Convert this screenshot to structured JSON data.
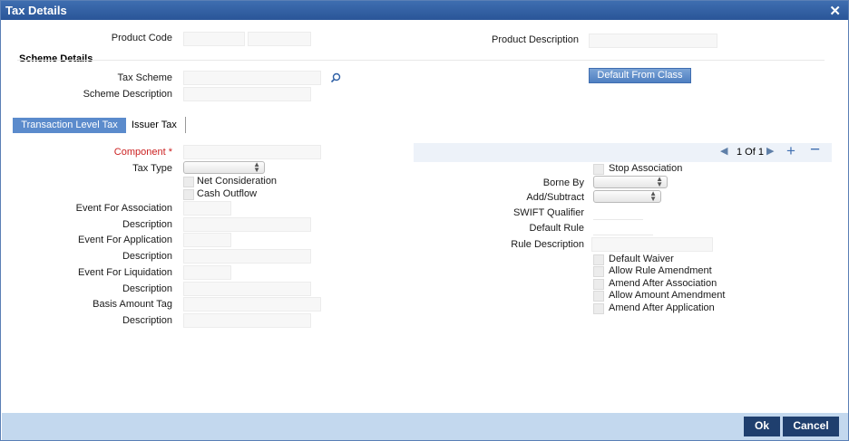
{
  "window": {
    "title": "Tax Details"
  },
  "header": {
    "product_code_label": "Product Code",
    "product_description_label": "Product Description"
  },
  "scheme": {
    "section_title": "Scheme Details",
    "tax_scheme_label": "Tax Scheme",
    "scheme_description_label": "Scheme Description",
    "default_button": "Default From Class"
  },
  "tabs": [
    "Transaction Level Tax",
    "Issuer Tax"
  ],
  "left": {
    "component_label": "Component",
    "required_mark": "*",
    "tax_type_label": "Tax Type",
    "net_consideration_label": "Net Consideration",
    "cash_outflow_label": "Cash Outflow",
    "event_association_label": "Event For Association",
    "description_1": "Description",
    "event_application_label": "Event For Application",
    "description_2": "Description",
    "event_liquidation_label": "Event For Liquidation",
    "description_3": "Description",
    "basis_amount_label": "Basis Amount Tag",
    "description_4": "Description"
  },
  "pager": {
    "text": "1 Of  1",
    "prev": "◀",
    "next": "▶",
    "add": "+",
    "remove": "−"
  },
  "right": {
    "stop_association": "Stop Association",
    "borne_by_label": "Borne By",
    "add_subtract_label": "Add/Subtract",
    "swift_qualifier_label": "SWIFT Qualifier",
    "default_rule_label": "Default Rule",
    "rule_description_label": "Rule Description",
    "default_waiver": "Default Waiver",
    "allow_rule_amendment": "Allow Rule Amendment",
    "amend_after_association": "Amend After Association",
    "allow_amount_amendment": "Allow Amount Amendment",
    "amend_after_application": "Amend After Application"
  },
  "footer": {
    "ok": "Ok",
    "cancel": "Cancel"
  },
  "icons": {
    "search": "search-icon",
    "close": "close-icon"
  }
}
